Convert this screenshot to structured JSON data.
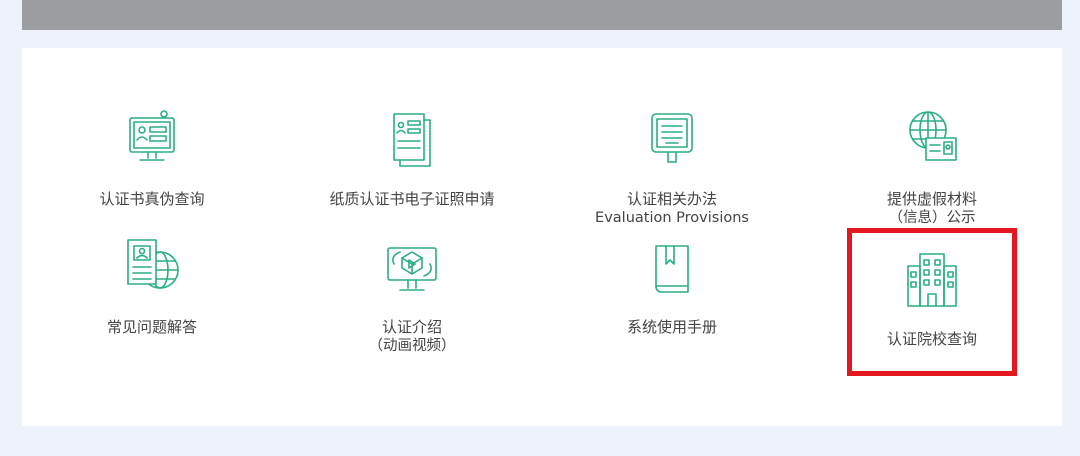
{
  "accent_color": "#2bae80",
  "highlight_color": "#e4161f",
  "tiles": [
    {
      "label": "认证书真伪查询",
      "label2": "",
      "icon": "monitor-id-icon"
    },
    {
      "label": "纸质认证书电子证照申请",
      "label2": "",
      "icon": "documents-icon"
    },
    {
      "label": "认证相关办法",
      "label2": "Evaluation Provisions",
      "icon": "notice-board-icon"
    },
    {
      "label": "提供虚假材料",
      "label2": "（信息）公示",
      "icon": "globe-card-icon"
    },
    {
      "label": "常见问题解答",
      "label2": "",
      "icon": "id-globe-icon"
    },
    {
      "label": "认证介绍",
      "label2": "（动画视频）",
      "icon": "video-monitor-icon"
    },
    {
      "label": "系统使用手册",
      "label2": "",
      "icon": "book-icon"
    },
    {
      "label": "认证院校查询",
      "label2": "",
      "icon": "building-icon"
    }
  ]
}
